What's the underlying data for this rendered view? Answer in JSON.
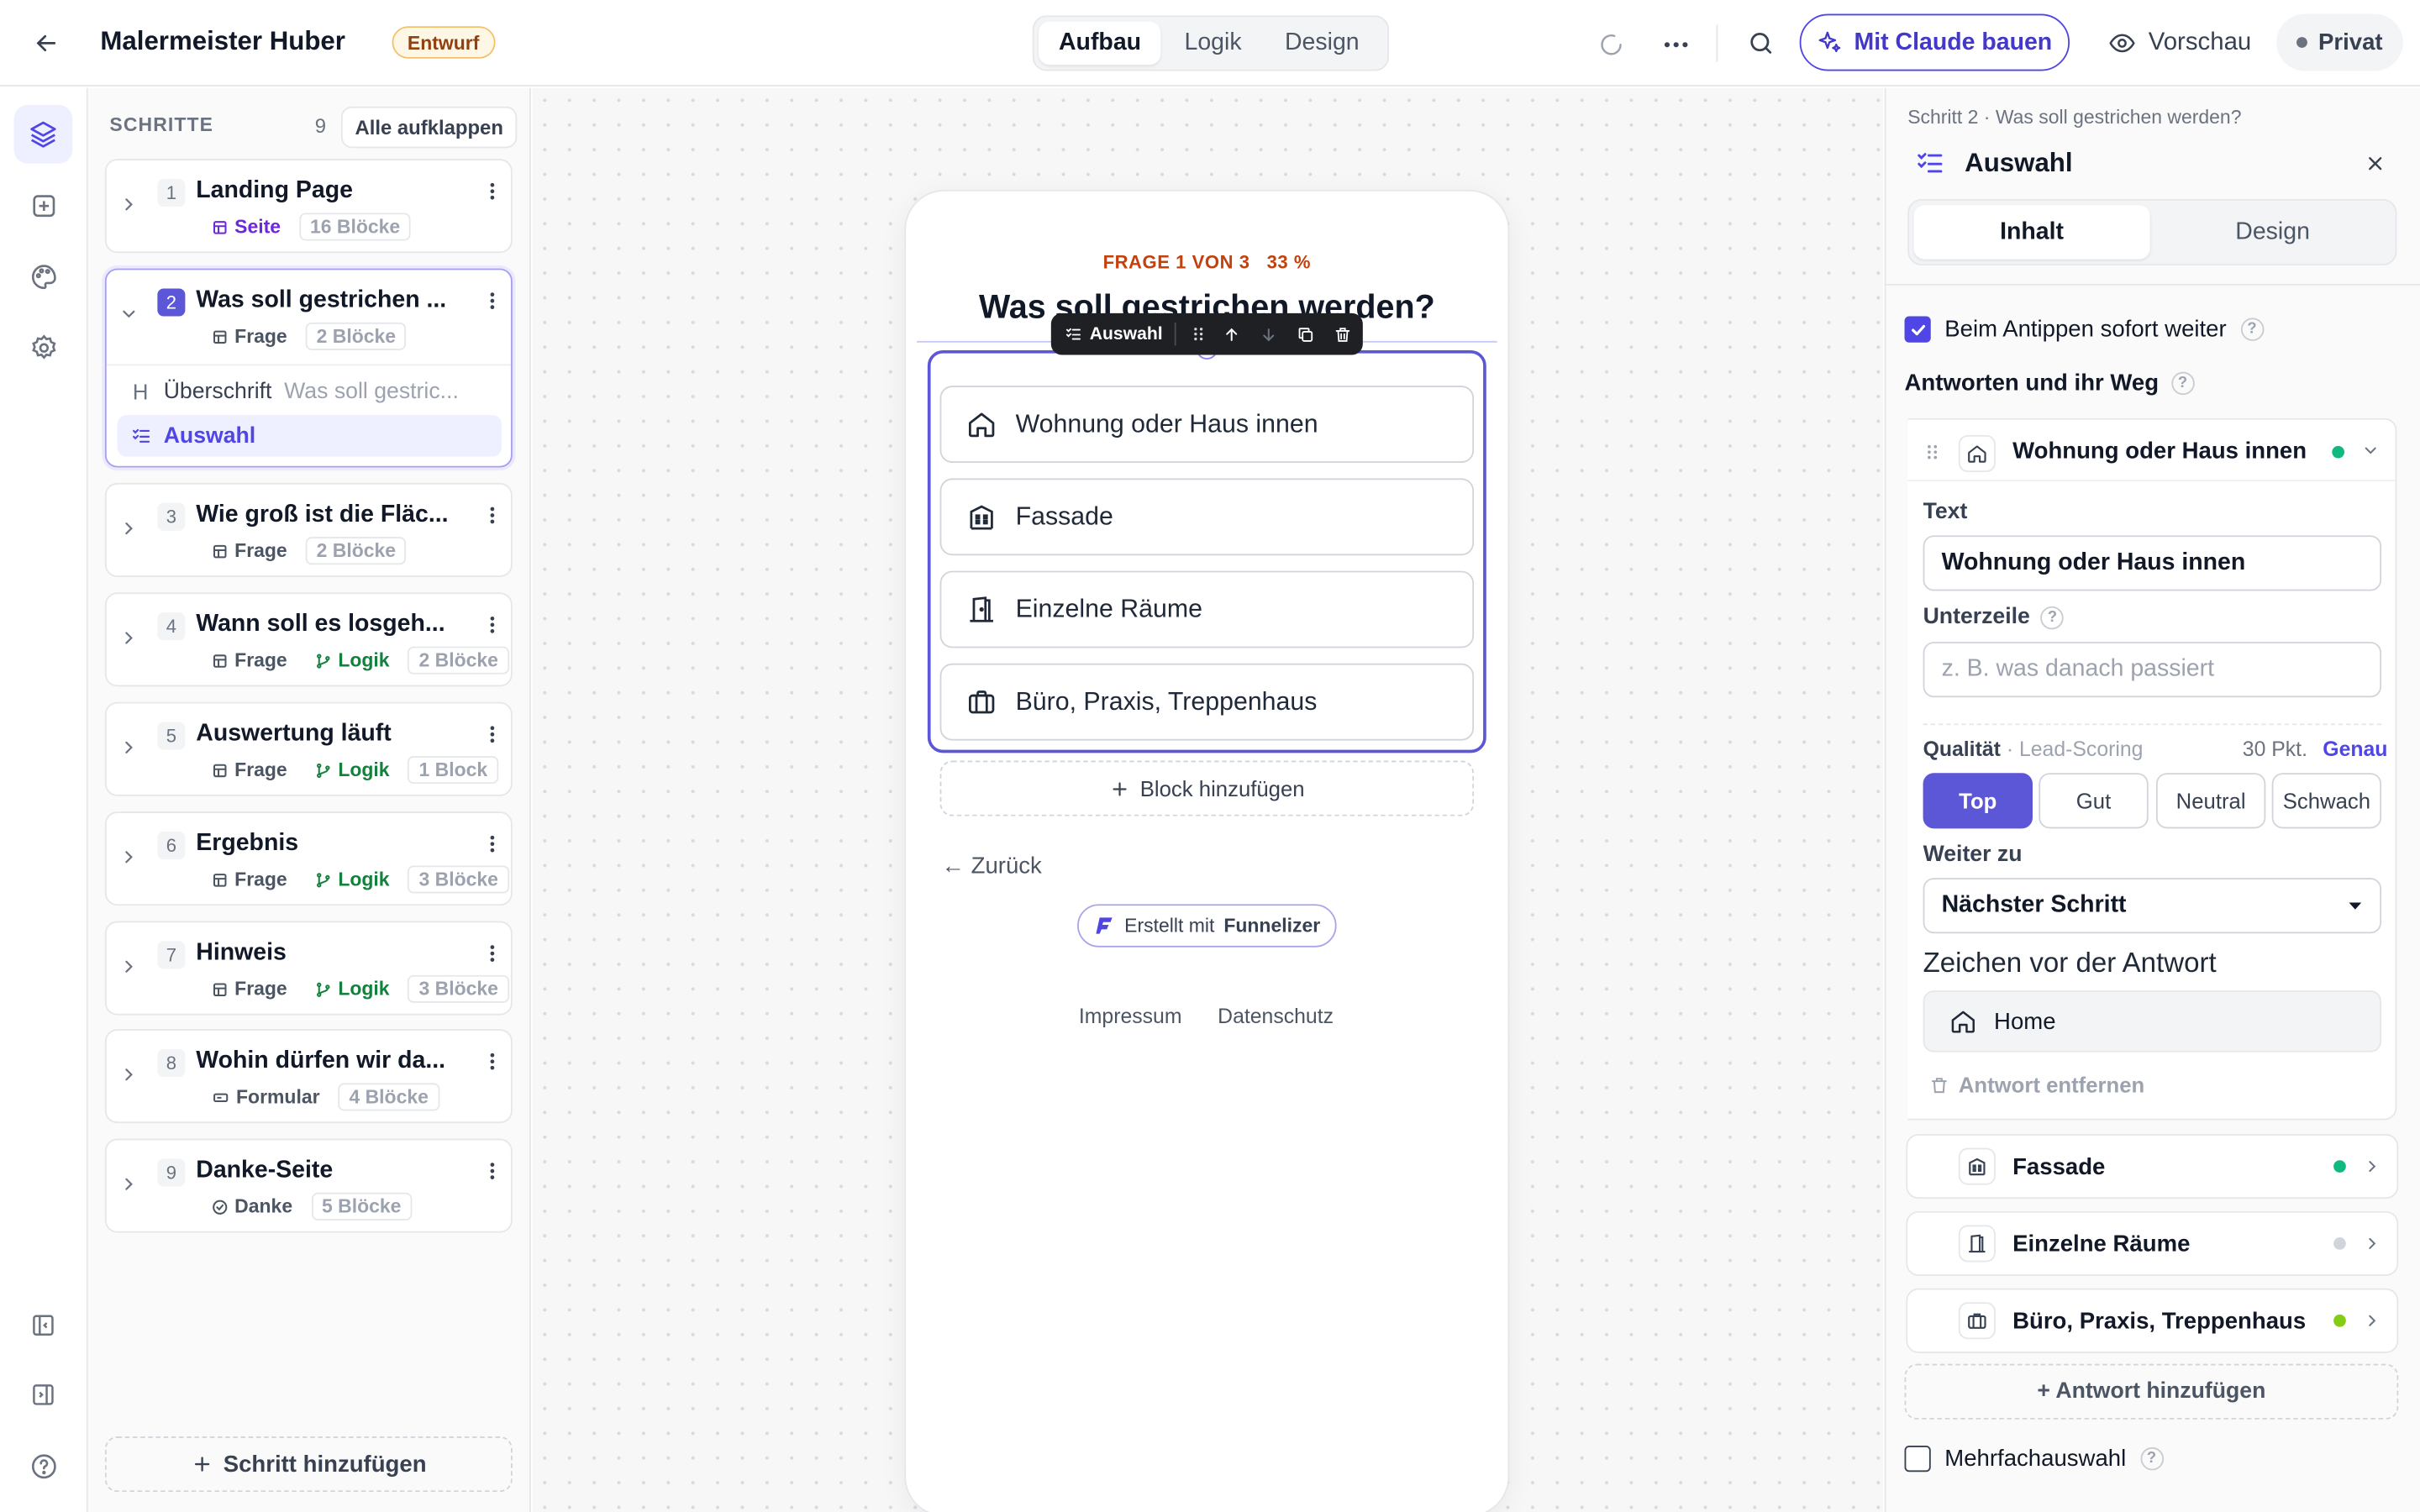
{
  "topbar": {
    "title": "Malermeister Huber",
    "status_badge": "Entwurf",
    "mode_tabs": [
      "Aufbau",
      "Logik",
      "Design"
    ],
    "active_mode": "Aufbau",
    "claude_button": "Mit Claude bauen",
    "preview_button": "Vorschau",
    "privacy_button": "Privat"
  },
  "steps_panel": {
    "heading": "SCHRITTE",
    "count": "9",
    "expand_all": "Alle aufklappen",
    "add_step": "Schritt hinzufügen",
    "steps": [
      {
        "num": "1",
        "title": "Landing Page",
        "type": "Seite",
        "logic": "",
        "blocks": "16 Blöcke"
      },
      {
        "num": "2",
        "title": "Was soll gestrichen ...",
        "type": "Frage",
        "logic": "",
        "blocks": "2 Blöcke"
      },
      {
        "num": "3",
        "title": "Wie groß ist die Fläc...",
        "type": "Frage",
        "logic": "",
        "blocks": "2 Blöcke"
      },
      {
        "num": "4",
        "title": "Wann soll es losgeh...",
        "type": "Frage",
        "logic": "Logik",
        "blocks": "2 Blöcke"
      },
      {
        "num": "5",
        "title": "Auswertung läuft",
        "type": "Frage",
        "logic": "Logik",
        "blocks": "1 Block"
      },
      {
        "num": "6",
        "title": "Ergebnis",
        "type": "Frage",
        "logic": "Logik",
        "blocks": "3 Blöcke"
      },
      {
        "num": "7",
        "title": "Hinweis",
        "type": "Frage",
        "logic": "Logik",
        "blocks": "3 Blöcke"
      },
      {
        "num": "8",
        "title": "Wohin dürfen wir da...",
        "type": "Formular",
        "logic": "",
        "blocks": "4 Blöcke"
      },
      {
        "num": "9",
        "title": "Danke-Seite",
        "type": "Danke",
        "logic": "",
        "blocks": "5 Blöcke"
      }
    ],
    "expanded_blocks": [
      {
        "icon": "H",
        "label": "Überschrift",
        "preview": "Was soll gestric..."
      },
      {
        "icon": "list-check-icon",
        "label": "Auswahl",
        "preview": ""
      }
    ]
  },
  "preview": {
    "progress": "FRAGE 1 VON 3",
    "progress_percent": "33 %",
    "question": "Was soll gestrichen werden?",
    "toolbar_label": "Auswahl",
    "options": [
      "Wohnung oder Haus innen",
      "Fassade",
      "Einzelne Räume",
      "Büro, Praxis, Treppenhaus"
    ],
    "add_block": "Block hinzufügen",
    "back": "← Zurück",
    "made_with": "Erstellt mit",
    "brand": "Funnelizer",
    "impressum": "Impressum",
    "datenschutz": "Datenschutz"
  },
  "inspector": {
    "breadcrumb": "Schritt 2 · Was soll gestrichen werden?",
    "title": "Auswahl",
    "tabs": [
      "Inhalt",
      "Design"
    ],
    "active_tab": "Inhalt",
    "auto_advance": "Beim Antippen sofort weiter",
    "auto_advance_checked": true,
    "answers_heading": "Antworten und ihr Weg",
    "expanded_answer": {
      "title": "Wohnung oder Haus innen",
      "text_label": "Text",
      "text_value": "Wohnung oder Haus innen",
      "subline_label": "Unterzeile",
      "subline_placeholder": "z. B. was danach passiert",
      "quality_label": "Qualität",
      "quality_sub": "· Lead-Scoring",
      "points": "30 Pkt.",
      "precise_link": "Genau",
      "quality_options": [
        "Top",
        "Gut",
        "Neutral",
        "Schwach"
      ],
      "quality_selected": "Top",
      "next_label": "Weiter zu",
      "next_value": "Nächster Schritt",
      "icon_label": "Zeichen vor der Antwort",
      "icon_value": "Home",
      "remove": "Antwort entfernen"
    },
    "other_answers": [
      {
        "label": "Fassade",
        "dot": "#10b981"
      },
      {
        "label": "Einzelne Räume",
        "dot": "#d1d5db"
      },
      {
        "label": "Büro, Praxis, Treppenhaus",
        "dot": "#84cc16"
      }
    ],
    "add_answer": "+ Antwort hinzufügen",
    "multi_select": "Mehrfachauswahl",
    "multi_select_checked": false
  },
  "colors": {
    "accent": "#4f46e5",
    "draft": "#92400e",
    "logic": "#15803d",
    "progress": "#c2410c"
  }
}
